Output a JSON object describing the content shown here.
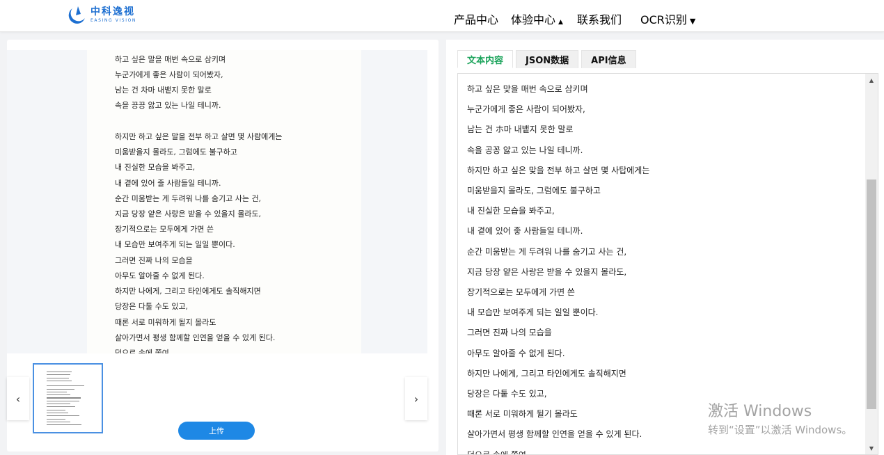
{
  "header": {
    "logo_cn": "中科逸视",
    "logo_en": "EASING VISION",
    "nav": {
      "products": "产品中心",
      "experience": "体验中心",
      "experience_caret": "▲",
      "contact": "联系我们",
      "ocr": "OCR识别",
      "ocr_caret": "▼"
    }
  },
  "left": {
    "doc_lines": [
      "하고 싶은 말을 매번 속으로 삼키며",
      "누군가에게 좋은 사람이 되어봤자,",
      "남는 건 차마 내뱉지 못한 말로",
      "속을 끙끙 앓고 있는 나일 테니까.",
      "하지만 하고 싶은 말을 전부 하고 살면 몇 사람에게는",
      "미움받을지 몰라도, 그럼에도 불구하고",
      "내 진실한 모습을 봐주고,",
      "내 곁에 있어 줄 사람들일 테니까.",
      "순간 미움받는 게 두려워 나를 숨기고 사는 건,",
      "지금 당장 얕은 사랑은 받을 수 있을지 몰라도,",
      "장기적으로는 모두에게 가면 쓴",
      "내 모습만 보여주게 되는 일일 뿐이다.",
      "그러면 진짜 나의 모습을",
      "아무도 알아줄 수 없게 된다.",
      "하지만 나에게, 그리고 타인에게도 솔직해지면",
      "당장은 다툴 수도 있고,",
      "때론 서로 미워하게 될지 몰라도",
      "살아가면서 평생 함께할 인연을 얻을 수 있게 된다.",
      "덕으로 속에 쫓여"
    ],
    "prev_label": "‹",
    "next_label": "›",
    "upload_label": "上传"
  },
  "right": {
    "tabs": [
      "文本内容",
      "JSON数据",
      "API信息"
    ],
    "active_tab": 0,
    "text_lines": [
      "하고 싶은 맞을 매번 속으로 삼키며",
      "누군가에게 좋은 사람이 되어봤자,",
      "남는 건 ホ마 내뱉지 못한 말로",
      "속을 공꽁 앓고 있는 나일 테니까.",
      "하지만 하고 싶은 맞을 전부 하고 살면 몇 사탑에게는",
      "미움받을지 몰라도, 그럼에도 불구하고",
      "내 진실한 모습을 봐주고,",
      "내 곁에 있어 좋 사람들일 테니까.",
      "순간 미움받는 게 두려워 나를 숨기고 사는 건,",
      "지금 당장 얕은 사랑은 받을 수 있을지 몰라도,",
      "장기적으로는 모두에게 가면 쓴",
      "내 모습만 보여주게 되는 일일 뿐이다.",
      "그러면 진짜 나의 모습을",
      "아무도 알아줄 수 없게 된다.",
      "하지만 나에게, 그리고 타인에게도 솔직해지면",
      "당장은 다퉅 수도 있고,",
      "때론 서로 미워하게 뒬기 몰라도",
      "살아가면서 평생 함께할 인연을 얻을 수 있게 된다.",
      "덕으로 속에 쫓여"
    ],
    "scroll_up": "▲",
    "scroll_down": "▼"
  },
  "watermark": {
    "title": "激活 Windows",
    "subtitle": "转到“设置”以激活 Windows。"
  },
  "colors": {
    "accent_blue": "#1e88e5",
    "active_tab_green": "#1aa35a",
    "logo_blue": "#1d6fd1"
  }
}
